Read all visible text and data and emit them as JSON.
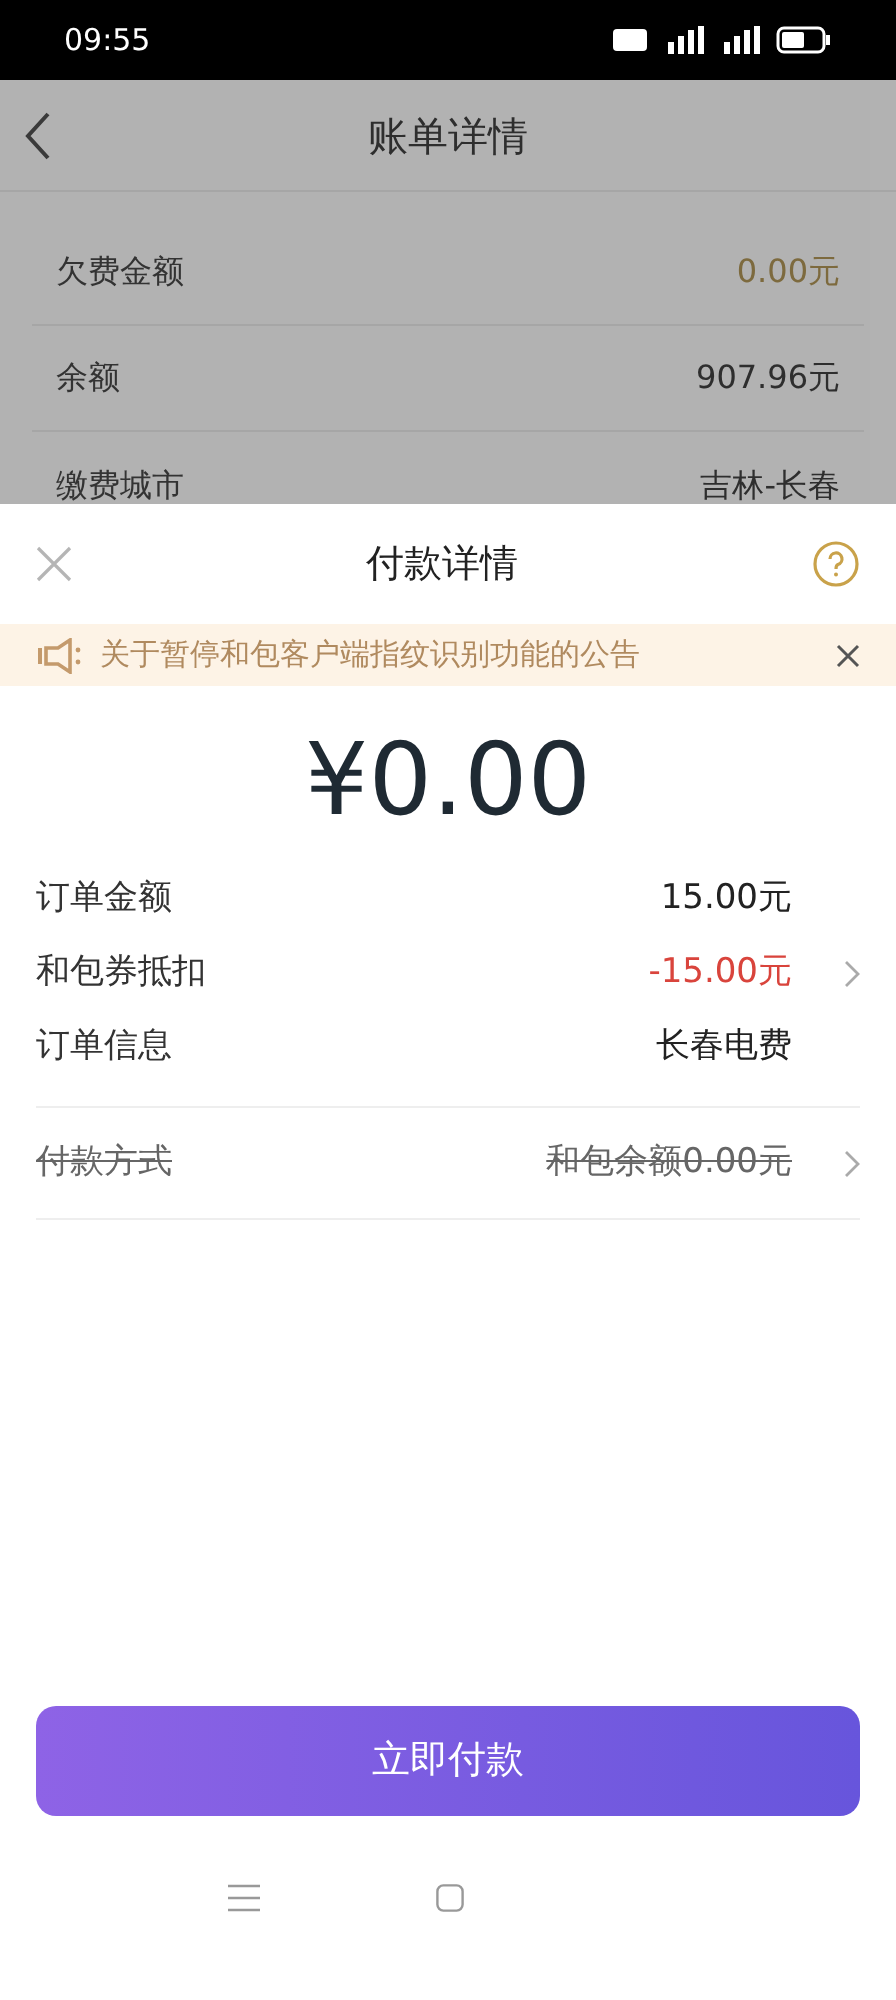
{
  "status_bar": {
    "time": "09:55"
  },
  "bill_page": {
    "title": "账单详情",
    "rows": [
      {
        "label": "欠费金额",
        "value": "0.00元",
        "kind": "due"
      },
      {
        "label": "余额",
        "value": "907.96元",
        "kind": "plain"
      },
      {
        "label": "缴费城市",
        "value": "吉林-长春",
        "kind": "plain"
      }
    ]
  },
  "sheet": {
    "title": "付款详情",
    "notice": "关于暂停和包客户端指纹识别功能的公告",
    "amount": "¥0.00",
    "rows": [
      {
        "label": "订单金额",
        "value": "15.00元",
        "kind": "plain",
        "arrow": false
      },
      {
        "label": "和包券抵扣",
        "value": "-15.00元",
        "kind": "discount",
        "arrow": true
      },
      {
        "label": "订单信息",
        "value": "长春电费",
        "kind": "plain",
        "arrow": false
      }
    ],
    "payment_method": {
      "label": "付款方式",
      "value": "和包余额0.00元",
      "disabled": true,
      "arrow": true
    },
    "pay_button": "立即付款"
  }
}
